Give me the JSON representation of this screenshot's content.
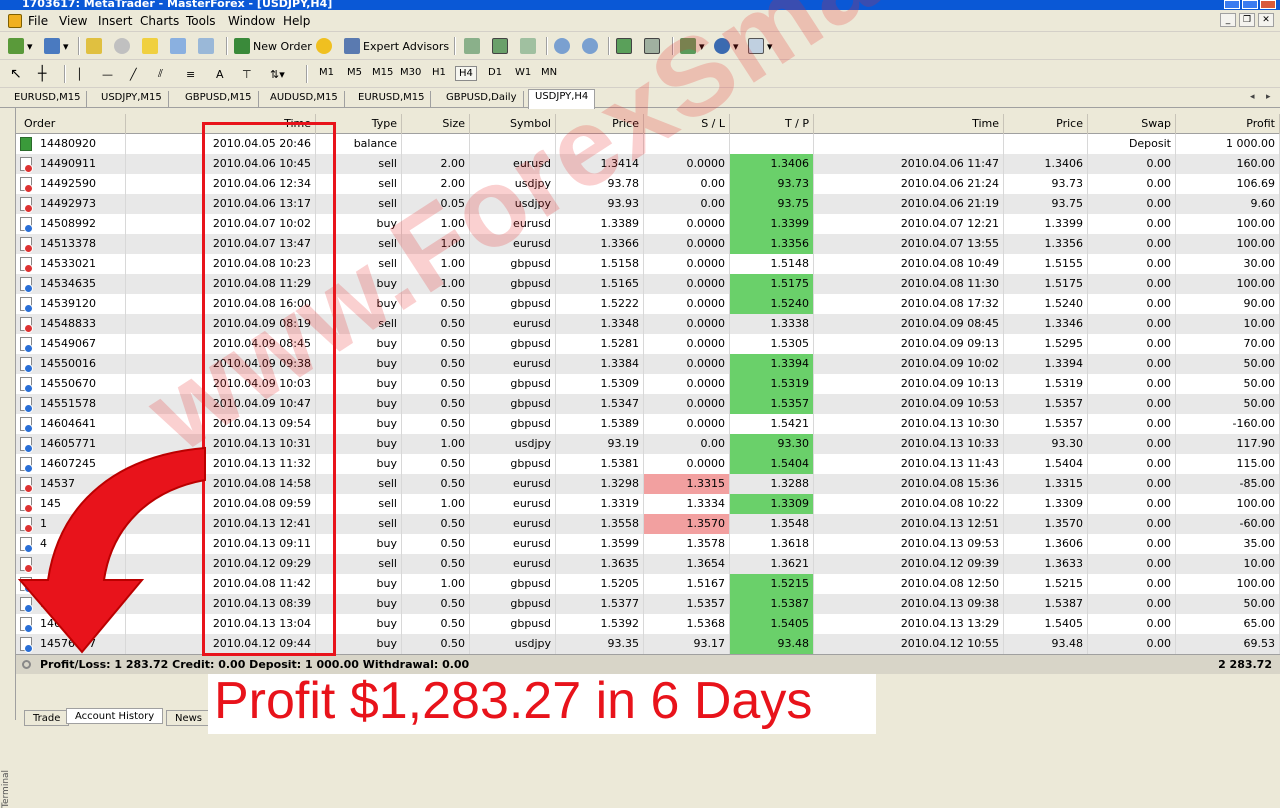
{
  "window": {
    "title": "1703617: MetaTrader - MasterForex - [USDJPY,H4]"
  },
  "menu": [
    "File",
    "View",
    "Insert",
    "Charts",
    "Tools",
    "Window",
    "Help"
  ],
  "toolbar": {
    "new_order": "New Order",
    "expert_advisors": "Expert Advisors",
    "timeframes": [
      "M1",
      "M5",
      "M15",
      "M30",
      "H1",
      "H4",
      "D1",
      "W1",
      "MN"
    ],
    "selected_timeframe": "H4"
  },
  "chart_tabs": [
    "EURUSD,M15",
    "USDJPY,M15",
    "GBPUSD,M15",
    "AUDUSD,M15",
    "EURUSD,M15",
    "GBPUSD,Daily",
    "USDJPY,H4"
  ],
  "active_chart_tab": "USDJPY,H4",
  "columns": [
    "Order",
    "Time",
    "Type",
    "Size",
    "Symbol",
    "Price",
    "S / L",
    "T / P",
    "Time",
    "Price",
    "Swap",
    "Profit"
  ],
  "rows": [
    {
      "order": "14480920",
      "time": "2010.04.05 20:46",
      "type": "balance",
      "size": "",
      "symbol": "",
      "price": "",
      "sl": "",
      "tp": "",
      "ctime": "",
      "cprice": "",
      "swap": "Deposit",
      "profit": "1 000.00",
      "hl": ""
    },
    {
      "order": "14490911",
      "time": "2010.04.06 10:45",
      "type": "sell",
      "size": "2.00",
      "symbol": "eurusd",
      "price": "1.3414",
      "sl": "0.0000",
      "tp": "1.3406",
      "ctime": "2010.04.06 11:47",
      "cprice": "1.3406",
      "swap": "0.00",
      "profit": "160.00",
      "hl": "tp"
    },
    {
      "order": "14492590",
      "time": "2010.04.06 12:34",
      "type": "sell",
      "size": "2.00",
      "symbol": "usdjpy",
      "price": "93.78",
      "sl": "0.00",
      "tp": "93.73",
      "ctime": "2010.04.06 21:24",
      "cprice": "93.73",
      "swap": "0.00",
      "profit": "106.69",
      "hl": "tp"
    },
    {
      "order": "14492973",
      "time": "2010.04.06 13:17",
      "type": "sell",
      "size": "0.05",
      "symbol": "usdjpy",
      "price": "93.93",
      "sl": "0.00",
      "tp": "93.75",
      "ctime": "2010.04.06 21:19",
      "cprice": "93.75",
      "swap": "0.00",
      "profit": "9.60",
      "hl": "tp"
    },
    {
      "order": "14508992",
      "time": "2010.04.07 10:02",
      "type": "buy",
      "size": "1.00",
      "symbol": "eurusd",
      "price": "1.3389",
      "sl": "0.0000",
      "tp": "1.3399",
      "ctime": "2010.04.07 12:21",
      "cprice": "1.3399",
      "swap": "0.00",
      "profit": "100.00",
      "hl": "tp"
    },
    {
      "order": "14513378",
      "time": "2010.04.07 13:47",
      "type": "sell",
      "size": "1.00",
      "symbol": "eurusd",
      "price": "1.3366",
      "sl": "0.0000",
      "tp": "1.3356",
      "ctime": "2010.04.07 13:55",
      "cprice": "1.3356",
      "swap": "0.00",
      "profit": "100.00",
      "hl": "tp"
    },
    {
      "order": "14533021",
      "time": "2010.04.08 10:23",
      "type": "sell",
      "size": "1.00",
      "symbol": "gbpusd",
      "price": "1.5158",
      "sl": "0.0000",
      "tp": "1.5148",
      "ctime": "2010.04.08 10:49",
      "cprice": "1.5155",
      "swap": "0.00",
      "profit": "30.00",
      "hl": ""
    },
    {
      "order": "14534635",
      "time": "2010.04.08 11:29",
      "type": "buy",
      "size": "1.00",
      "symbol": "gbpusd",
      "price": "1.5165",
      "sl": "0.0000",
      "tp": "1.5175",
      "ctime": "2010.04.08 11:30",
      "cprice": "1.5175",
      "swap": "0.00",
      "profit": "100.00",
      "hl": "tp"
    },
    {
      "order": "14539120",
      "time": "2010.04.08 16:00",
      "type": "buy",
      "size": "0.50",
      "symbol": "gbpusd",
      "price": "1.5222",
      "sl": "0.0000",
      "tp": "1.5240",
      "ctime": "2010.04.08 17:32",
      "cprice": "1.5240",
      "swap": "0.00",
      "profit": "90.00",
      "hl": "tp"
    },
    {
      "order": "14548833",
      "time": "2010.04.09 08:19",
      "type": "sell",
      "size": "0.50",
      "symbol": "eurusd",
      "price": "1.3348",
      "sl": "0.0000",
      "tp": "1.3338",
      "ctime": "2010.04.09 08:45",
      "cprice": "1.3346",
      "swap": "0.00",
      "profit": "10.00",
      "hl": ""
    },
    {
      "order": "14549067",
      "time": "2010.04.09 08:45",
      "type": "buy",
      "size": "0.50",
      "symbol": "gbpusd",
      "price": "1.5281",
      "sl": "0.0000",
      "tp": "1.5305",
      "ctime": "2010.04.09 09:13",
      "cprice": "1.5295",
      "swap": "0.00",
      "profit": "70.00",
      "hl": ""
    },
    {
      "order": "14550016",
      "time": "2010.04.09 09:38",
      "type": "buy",
      "size": "0.50",
      "symbol": "eurusd",
      "price": "1.3384",
      "sl": "0.0000",
      "tp": "1.3394",
      "ctime": "2010.04.09 10:02",
      "cprice": "1.3394",
      "swap": "0.00",
      "profit": "50.00",
      "hl": "tp"
    },
    {
      "order": "14550670",
      "time": "2010.04.09 10:03",
      "type": "buy",
      "size": "0.50",
      "symbol": "gbpusd",
      "price": "1.5309",
      "sl": "0.0000",
      "tp": "1.5319",
      "ctime": "2010.04.09 10:13",
      "cprice": "1.5319",
      "swap": "0.00",
      "profit": "50.00",
      "hl": "tp"
    },
    {
      "order": "14551578",
      "time": "2010.04.09 10:47",
      "type": "buy",
      "size": "0.50",
      "symbol": "gbpusd",
      "price": "1.5347",
      "sl": "0.0000",
      "tp": "1.5357",
      "ctime": "2010.04.09 10:53",
      "cprice": "1.5357",
      "swap": "0.00",
      "profit": "50.00",
      "hl": "tp"
    },
    {
      "order": "14604641",
      "time": "2010.04.13 09:54",
      "type": "buy",
      "size": "0.50",
      "symbol": "gbpusd",
      "price": "1.5389",
      "sl": "0.0000",
      "tp": "1.5421",
      "ctime": "2010.04.13 10:30",
      "cprice": "1.5357",
      "swap": "0.00",
      "profit": "-160.00",
      "hl": ""
    },
    {
      "order": "14605771",
      "time": "2010.04.13 10:31",
      "type": "buy",
      "size": "1.00",
      "symbol": "usdjpy",
      "price": "93.19",
      "sl": "0.00",
      "tp": "93.30",
      "ctime": "2010.04.13 10:33",
      "cprice": "93.30",
      "swap": "0.00",
      "profit": "117.90",
      "hl": "tp"
    },
    {
      "order": "14607245",
      "time": "2010.04.13 11:32",
      "type": "buy",
      "size": "0.50",
      "symbol": "gbpusd",
      "price": "1.5381",
      "sl": "0.0000",
      "tp": "1.5404",
      "ctime": "2010.04.13 11:43",
      "cprice": "1.5404",
      "swap": "0.00",
      "profit": "115.00",
      "hl": "tp"
    },
    {
      "order": "14537",
      "time": "2010.04.08 14:58",
      "type": "sell",
      "size": "0.50",
      "symbol": "eurusd",
      "price": "1.3298",
      "sl": "1.3315",
      "tp": "1.3288",
      "ctime": "2010.04.08 15:36",
      "cprice": "1.3315",
      "swap": "0.00",
      "profit": "-85.00",
      "hl": "sl"
    },
    {
      "order": "145",
      "time": "2010.04.08 09:59",
      "type": "sell",
      "size": "1.00",
      "symbol": "eurusd",
      "price": "1.3319",
      "sl": "1.3334",
      "tp": "1.3309",
      "ctime": "2010.04.08 10:22",
      "cprice": "1.3309",
      "swap": "0.00",
      "profit": "100.00",
      "hl": "tp"
    },
    {
      "order": "1",
      "time": "2010.04.13 12:41",
      "type": "sell",
      "size": "0.50",
      "symbol": "eurusd",
      "price": "1.3558",
      "sl": "1.3570",
      "tp": "1.3548",
      "ctime": "2010.04.13 12:51",
      "cprice": "1.3570",
      "swap": "0.00",
      "profit": "-60.00",
      "hl": "sl"
    },
    {
      "order": "4",
      "time": "2010.04.13 09:11",
      "type": "buy",
      "size": "0.50",
      "symbol": "eurusd",
      "price": "1.3599",
      "sl": "1.3578",
      "tp": "1.3618",
      "ctime": "2010.04.13 09:53",
      "cprice": "1.3606",
      "swap": "0.00",
      "profit": "35.00",
      "hl": ""
    },
    {
      "order": "",
      "time": "2010.04.12 09:29",
      "type": "sell",
      "size": "0.50",
      "symbol": "eurusd",
      "price": "1.3635",
      "sl": "1.3654",
      "tp": "1.3621",
      "ctime": "2010.04.12 09:39",
      "cprice": "1.3633",
      "swap": "0.00",
      "profit": "10.00",
      "hl": ""
    },
    {
      "order": "",
      "time": "2010.04.08 11:42",
      "type": "buy",
      "size": "1.00",
      "symbol": "gbpusd",
      "price": "1.5205",
      "sl": "1.5167",
      "tp": "1.5215",
      "ctime": "2010.04.08 12:50",
      "cprice": "1.5215",
      "swap": "0.00",
      "profit": "100.00",
      "hl": "tp"
    },
    {
      "order": "14",
      "time": "2010.04.13 08:39",
      "type": "buy",
      "size": "0.50",
      "symbol": "gbpusd",
      "price": "1.5377",
      "sl": "1.5357",
      "tp": "1.5387",
      "ctime": "2010.04.13 09:38",
      "cprice": "1.5387",
      "swap": "0.00",
      "profit": "50.00",
      "hl": "tp"
    },
    {
      "order": "146",
      "time": "2010.04.13 13:04",
      "type": "buy",
      "size": "0.50",
      "symbol": "gbpusd",
      "price": "1.5392",
      "sl": "1.5368",
      "tp": "1.5405",
      "ctime": "2010.04.13 13:29",
      "cprice": "1.5405",
      "swap": "0.00",
      "profit": "65.00",
      "hl": "tp"
    },
    {
      "order": "14576307",
      "time": "2010.04.12 09:44",
      "type": "buy",
      "size": "0.50",
      "symbol": "usdjpy",
      "price": "93.35",
      "sl": "93.17",
      "tp": "93.48",
      "ctime": "2010.04.12 10:55",
      "cprice": "93.48",
      "swap": "0.00",
      "profit": "69.53",
      "hl": "tp"
    }
  ],
  "summary": {
    "text": "Profit/Loss: 1 283.72  Credit: 0.00  Deposit: 1 000.00  Withdrawal: 0.00",
    "total": "2 283.72"
  },
  "bottom_tabs": [
    "Trade",
    "Account History",
    "News"
  ],
  "side_label": "Terminal",
  "watermark": "www.ForexSmartTips.com",
  "caption": "Profit $1,283.27 in 6 Days",
  "colors": {
    "tp_hit": "#6ad06a",
    "sl_hit": "#f2a0a0",
    "annotation": "#e8131b"
  }
}
